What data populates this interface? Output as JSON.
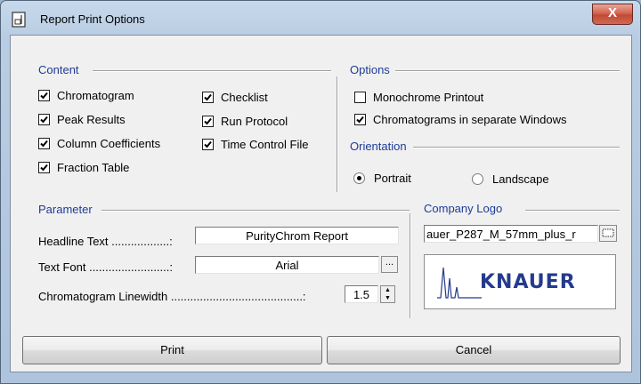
{
  "window": {
    "title": "Report Print Options",
    "close_label": "X"
  },
  "content": {
    "title": "Content",
    "items_col1": [
      {
        "label": "Chromatogram",
        "checked": true
      },
      {
        "label": "Peak Results",
        "checked": true
      },
      {
        "label": "Column Coefficients",
        "checked": true
      },
      {
        "label": "Fraction Table",
        "checked": true
      }
    ],
    "items_col2": [
      {
        "label": "Checklist",
        "checked": true
      },
      {
        "label": "Run Protocol",
        "checked": true
      },
      {
        "label": "Time Control File",
        "checked": true
      }
    ]
  },
  "options": {
    "title": "Options",
    "items": [
      {
        "label": "Monochrome Printout",
        "checked": false
      },
      {
        "label": "Chromatograms in separate Windows",
        "checked": true
      }
    ]
  },
  "orientation": {
    "title": "Orientation",
    "portrait": {
      "label": "Portrait",
      "selected": true
    },
    "landscape": {
      "label": "Landscape",
      "selected": false
    }
  },
  "parameter": {
    "title": "Parameter",
    "headline_label": "Headline Text ..................:",
    "headline_value": "PurityChrom Report",
    "font_label": "Text Font .........................:",
    "font_value": "Arial",
    "font_browse": "...",
    "linewidth_label": "Chromatogram Linewidth .........................................:",
    "linewidth_value": "1.5"
  },
  "company_logo": {
    "title": "Company Logo",
    "file_value": "auer_P287_M_57mm_plus_r",
    "logo_text": "KNAUER"
  },
  "buttons": {
    "print": "Print",
    "cancel": "Cancel"
  },
  "colors": {
    "section_title": "#1e3c96",
    "logo": "#243a8c",
    "close_button": "#c24a35"
  }
}
